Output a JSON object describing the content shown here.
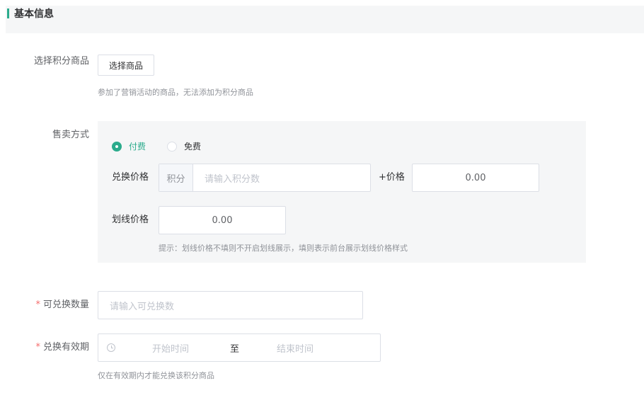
{
  "section": {
    "title": "基本信息"
  },
  "product": {
    "label": "选择积分商品",
    "button": "选择商品",
    "hint": "参加了营销活动的商品，无法添加为积分商品"
  },
  "sale": {
    "label": "售卖方式",
    "options": [
      {
        "label": "付费",
        "checked": true
      },
      {
        "label": "免费",
        "checked": false
      }
    ],
    "price_label": "兑换价格",
    "points_prefix": "积分",
    "points_placeholder": "请输入积分数",
    "plus_price_label": "+价格",
    "price_value": "0.00",
    "strike_label": "划线价格",
    "strike_value": "0.00",
    "strike_hint": "提示：划线价格不填则不开启划线展示，填则表示前台展示划线价格样式"
  },
  "quantity": {
    "required": "*",
    "label": "可兑换数量",
    "placeholder": "请输入可兑换数"
  },
  "validity": {
    "required": "*",
    "label": "兑换有效期",
    "start_placeholder": "开始时间",
    "separator": "至",
    "end_placeholder": "结束时间",
    "hint": "仅在有效期内才能兑换该积分商品"
  },
  "colors": {
    "accent": "#2bab8c",
    "required": "#f56c6c",
    "panel_bg": "#f5f6f7"
  }
}
